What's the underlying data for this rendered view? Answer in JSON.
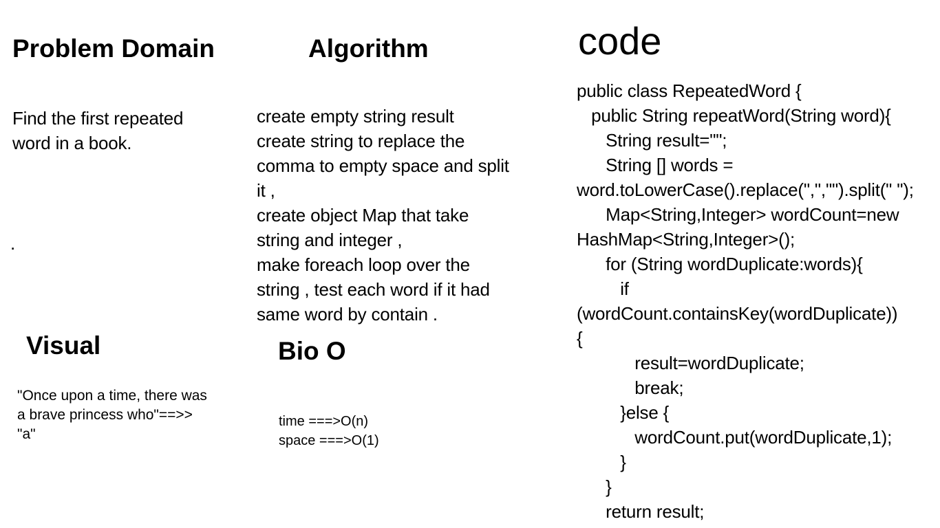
{
  "problem_domain": {
    "heading": "Problem Domain",
    "lines": [
      "Find the first repeated",
      "word in a book."
    ],
    "dot": "."
  },
  "algorithm": {
    "heading": "Algorithm",
    "lines": [
      "create  empty string result",
      "create string to replace  the",
      "comma to empty space and split",
      "it ,",
      "create object Map that take",
      "string and integer ,",
      "make foreach loop  over the",
      "string , test each word if it had",
      "same word by contain ."
    ]
  },
  "code": {
    "heading": "code",
    "lines": [
      "public class RepeatedWord {",
      "   public String repeatWord(String word){",
      "      String result=\"\";",
      "      String [] words =",
      "word.toLowerCase().replace(\",\",\"\").split(\" \");",
      "      Map<String,Integer> wordCount=new",
      "HashMap<String,Integer>();",
      "      for (String wordDuplicate:words){",
      "         if",
      "(wordCount.containsKey(wordDuplicate))",
      "{",
      "            result=wordDuplicate;",
      "            break;",
      "         }else {",
      "            wordCount.put(wordDuplicate,1);",
      "         }",
      "      }",
      "      return result;"
    ]
  },
  "visual": {
    "heading": "Visual",
    "lines": [
      "\"Once upon a time, there was",
      "a brave princess who\"==>>",
      "\"a\""
    ]
  },
  "big_o": {
    "heading": "Bio O",
    "time": "time ===>O(n)",
    "space": "space ===>O(1)"
  }
}
